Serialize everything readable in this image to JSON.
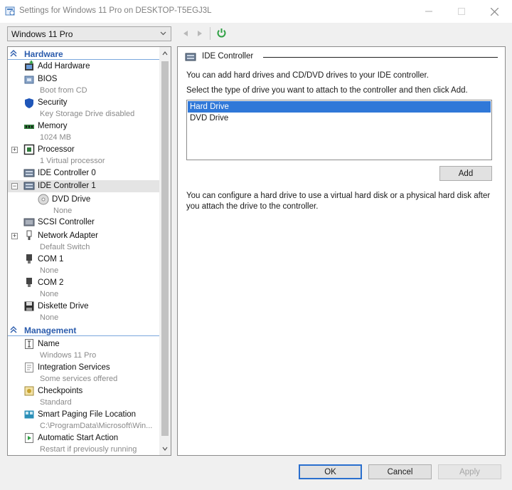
{
  "window": {
    "title": "Settings for Windows 11 Pro on DESKTOP-T5EGJ3L"
  },
  "vm_selector": {
    "value": "Windows 11 Pro"
  },
  "hardware_section": {
    "label": "Hardware",
    "items": [
      {
        "name": "Add Hardware",
        "sub": ""
      },
      {
        "name": "BIOS",
        "sub": "Boot from CD"
      },
      {
        "name": "Security",
        "sub": "Key Storage Drive disabled"
      },
      {
        "name": "Memory",
        "sub": "1024 MB"
      },
      {
        "name": "Processor",
        "sub": "1 Virtual processor"
      },
      {
        "name": "IDE Controller 0",
        "sub": ""
      },
      {
        "name": "IDE Controller 1",
        "sub": ""
      },
      {
        "name": "DVD Drive",
        "sub": "None"
      },
      {
        "name": "SCSI Controller",
        "sub": ""
      },
      {
        "name": "Network Adapter",
        "sub": "Default Switch"
      },
      {
        "name": "COM 1",
        "sub": "None"
      },
      {
        "name": "COM 2",
        "sub": "None"
      },
      {
        "name": "Diskette Drive",
        "sub": "None"
      }
    ]
  },
  "management_section": {
    "label": "Management",
    "items": [
      {
        "name": "Name",
        "sub": "Windows 11 Pro"
      },
      {
        "name": "Integration Services",
        "sub": "Some services offered"
      },
      {
        "name": "Checkpoints",
        "sub": "Standard"
      },
      {
        "name": "Smart Paging File Location",
        "sub": "C:\\ProgramData\\Microsoft\\Win..."
      },
      {
        "name": "Automatic Start Action",
        "sub": "Restart if previously running"
      }
    ]
  },
  "panel": {
    "group_title": "IDE Controller",
    "desc1": "You can add hard drives and CD/DVD drives to your IDE controller.",
    "desc2": "Select the type of drive you want to attach to the controller and then click Add.",
    "drive_types": [
      "Hard Drive",
      "DVD Drive"
    ],
    "selected_drive_type": "Hard Drive",
    "add_label": "Add",
    "info": "You can configure a hard drive to use a virtual hard disk or a physical hard disk after you attach the drive to the controller."
  },
  "footer": {
    "ok_label": "OK",
    "cancel_label": "Cancel",
    "apply_label": "Apply"
  },
  "colors": {
    "accent": "#3078d8",
    "section_header": "#2b5cad",
    "refresh_green": "#2ea043"
  }
}
